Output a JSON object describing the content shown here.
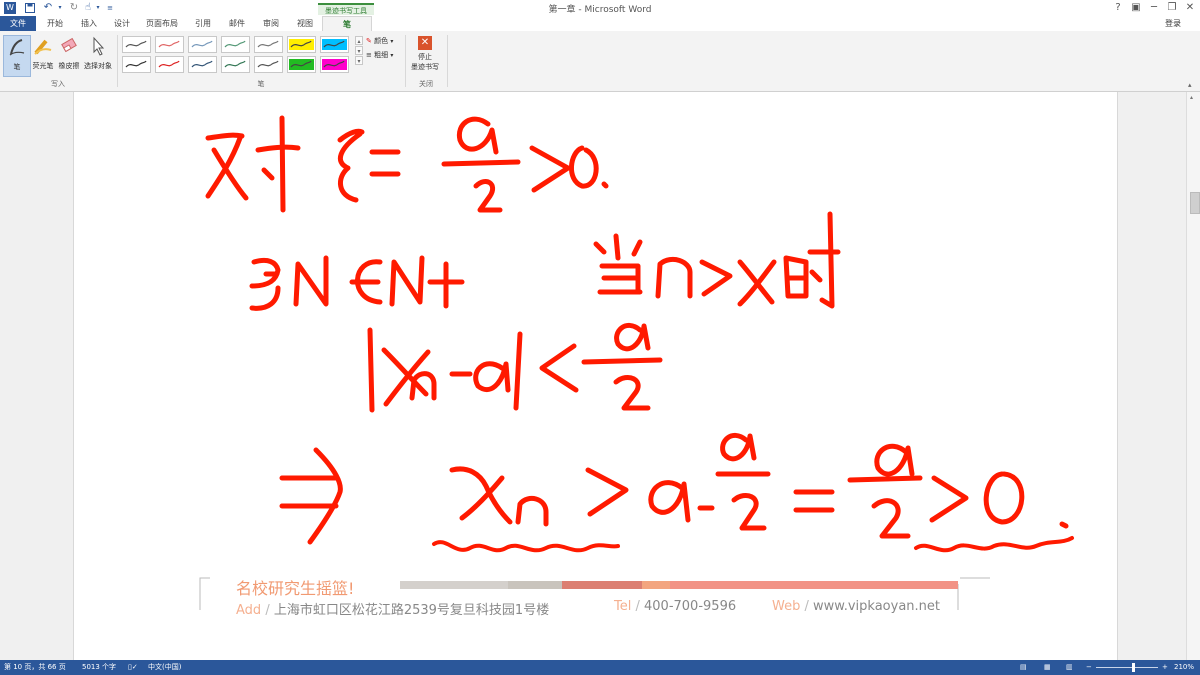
{
  "title_bar": {
    "title": "第一章 - Microsoft Word",
    "help": "?",
    "login": "登录"
  },
  "tabs": {
    "context_header": "墨迹书写工具",
    "items": [
      "文件",
      "开始",
      "插入",
      "设计",
      "页面布局",
      "引用",
      "邮件",
      "审阅",
      "视图",
      "笔"
    ]
  },
  "ribbon": {
    "write_group": {
      "name": "写入",
      "tools": [
        "笔",
        "荧光笔",
        "橡皮擦",
        "选择对象"
      ]
    },
    "pens_group": {
      "name": "笔",
      "colors_row1": [
        "#555555",
        "#e06666",
        "#7799bb",
        "#559977",
        "#777777",
        "#ffee00",
        "#00bfff"
      ],
      "colors_row2": [
        "#333333",
        "#dd2222",
        "#335577",
        "#337755",
        "#555555",
        "#22bb22",
        "#ff00cc"
      ],
      "color_label": "颜色",
      "thickness_label": "粗细"
    },
    "close_group": {
      "name": "关闭",
      "stop_label_line1": "停止",
      "stop_label_line2": "墨迹书写"
    }
  },
  "ink_color": "#ff1a00",
  "watermark": {
    "title": "名校研究生摇篮!",
    "addr_key": "Add",
    "addr_val": "上海市虹口区松花江路2539号复旦科技园1号楼",
    "tel_key": "Tel",
    "tel_val": "400-700-9596",
    "web_key": "Web",
    "web_val": "www.vipkaoyan.net",
    "slash": "/"
  },
  "status_bar": {
    "page": "第 10 页，共 66 页",
    "words": "5013 个字",
    "language": "中文(中国)",
    "zoom": "210%"
  }
}
